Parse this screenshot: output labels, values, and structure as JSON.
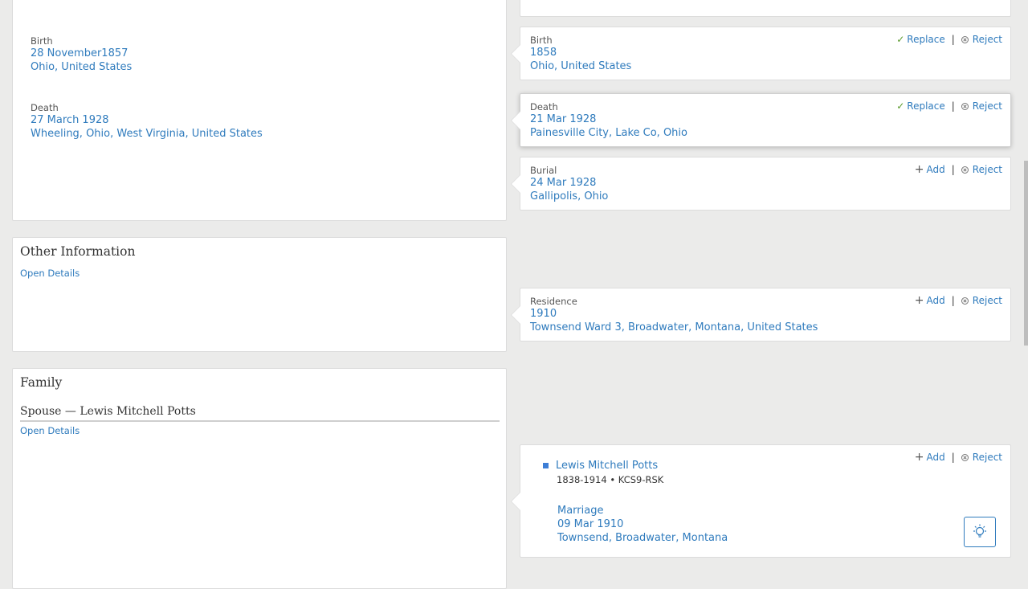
{
  "left": {
    "vitals": {
      "birth_label": "Birth",
      "birth_date": "28 November1857",
      "birth_place": "Ohio, United States",
      "death_label": "Death",
      "death_date": "27 March 1928",
      "death_place": "Wheeling, Ohio, West Virginia, United States"
    },
    "other": {
      "title": "Other Information",
      "link": "Open Details"
    },
    "family": {
      "title": "Family",
      "spouse_heading": "Spouse — Lewis Mitchell Potts",
      "link": "Open Details"
    }
  },
  "right": {
    "birth": {
      "label": "Birth",
      "date": "1858",
      "place": "Ohio, United States",
      "primary_action": "Replace",
      "reject": "Reject"
    },
    "death": {
      "label": "Death",
      "date": "21 Mar 1928",
      "place": "Painesville City, Lake Co, Ohio",
      "primary_action": "Replace",
      "reject": "Reject"
    },
    "burial": {
      "label": "Burial",
      "date": "24 Mar 1928",
      "place": "Gallipolis, Ohio",
      "primary_action": "Add",
      "reject": "Reject"
    },
    "residence": {
      "label": "Residence",
      "date": "1910",
      "place": "Townsend Ward 3, Broadwater, Montana, United States",
      "primary_action": "Add",
      "reject": "Reject"
    },
    "spouse": {
      "name": "Lewis Mitchell Potts",
      "years_id": "1838-1914  •  KCS9-RSK",
      "marriage_label": "Marriage",
      "marriage_date": "09 Mar 1910",
      "marriage_place": "Townsend, Broadwater, Montana",
      "primary_action": "Add",
      "reject": "Reject"
    }
  },
  "icons": {
    "replace": "check-icon",
    "add": "plus-icon",
    "reject": "reject-circle-icon",
    "hint": "lightbulb-icon"
  },
  "colors": {
    "link": "#2f7bbd",
    "accept": "#5a9a2c",
    "page_bg": "#ebebea"
  }
}
